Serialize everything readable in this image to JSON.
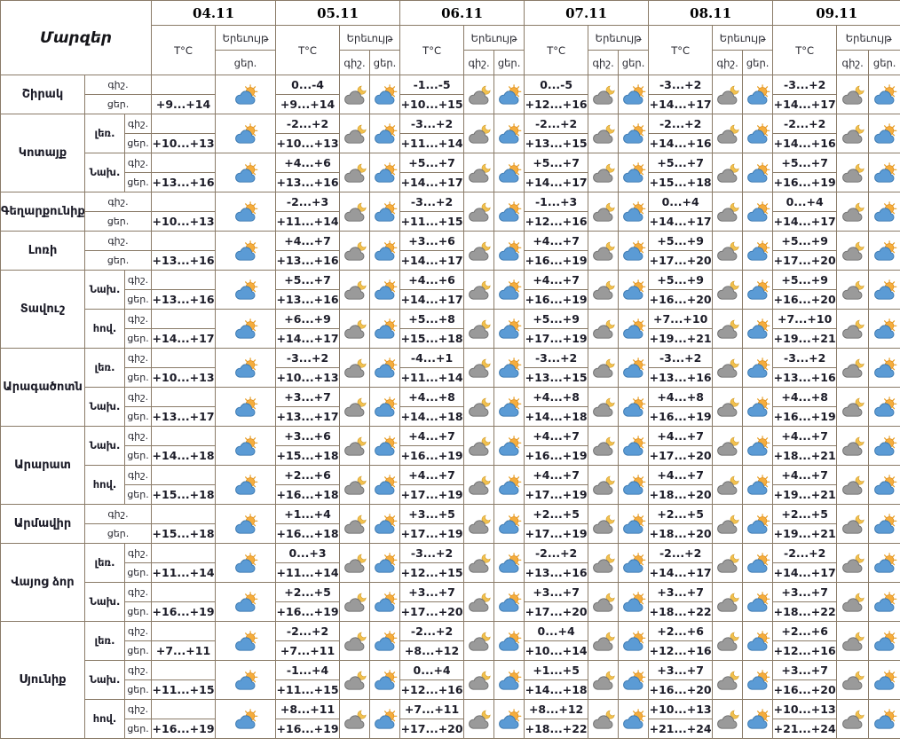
{
  "table": {
    "corner_label": "Մարզեր",
    "dates": [
      "04.11",
      "05.11",
      "06.11",
      "07.11",
      "08.11",
      "09.11"
    ],
    "temp_header": "T°C",
    "phenomenon_header": "Երեւույթ",
    "night_label": "գիշ.",
    "day_label": "ցեր.",
    "night_icon": "cloud-moon-icon",
    "day_icon": "cloud-sun-icon",
    "colors": {
      "border": "#8a7b68",
      "text": "#1c1c28",
      "day_cloud": "#5b9bd5",
      "night_cloud": "#9a9a9a",
      "sun": "#f5ad3d",
      "moon": "#f2c14e"
    },
    "regions": [
      {
        "name": "Շիրակ",
        "zones": [
          {
            "label": null,
            "cells": [
              {
                "night": "",
                "day": "+9...+14"
              },
              {
                "night": "0...-4",
                "day": "+9...+14"
              },
              {
                "night": "-1...-5",
                "day": "+10...+15"
              },
              {
                "night": "0...-5",
                "day": "+12...+16"
              },
              {
                "night": "-3...+2",
                "day": "+14...+17"
              },
              {
                "night": "-3...+2",
                "day": "+14...+17"
              }
            ]
          }
        ]
      },
      {
        "name": "Կոտայք",
        "zones": [
          {
            "label": "լեռ.",
            "cells": [
              {
                "night": "",
                "day": "+10...+13"
              },
              {
                "night": "-2...+2",
                "day": "+10...+13"
              },
              {
                "night": "-3...+2",
                "day": "+11...+14"
              },
              {
                "night": "-2...+2",
                "day": "+13...+15"
              },
              {
                "night": "-2...+2",
                "day": "+14...+16"
              },
              {
                "night": "-2...+2",
                "day": "+14...+16"
              }
            ]
          },
          {
            "label": "Նախ.",
            "cells": [
              {
                "night": "",
                "day": "+13...+16"
              },
              {
                "night": "+4...+6",
                "day": "+13...+16"
              },
              {
                "night": "+5...+7",
                "day": "+14...+17"
              },
              {
                "night": "+5...+7",
                "day": "+14...+17"
              },
              {
                "night": "+5...+7",
                "day": "+15...+18"
              },
              {
                "night": "+5...+7",
                "day": "+16...+19"
              }
            ]
          }
        ]
      },
      {
        "name": "Գեղարքունիք",
        "zones": [
          {
            "label": null,
            "cells": [
              {
                "night": "",
                "day": "+10...+13"
              },
              {
                "night": "-2...+3",
                "day": "+11...+14"
              },
              {
                "night": "-3...+2",
                "day": "+11...+15"
              },
              {
                "night": "-1...+3",
                "day": "+12...+16"
              },
              {
                "night": "0...+4",
                "day": "+14...+17"
              },
              {
                "night": "0...+4",
                "day": "+14...+17"
              }
            ]
          }
        ]
      },
      {
        "name": "Լոռի",
        "zones": [
          {
            "label": null,
            "cells": [
              {
                "night": "",
                "day": "+13...+16"
              },
              {
                "night": "+4...+7",
                "day": "+13...+16"
              },
              {
                "night": "+3...+6",
                "day": "+14...+17"
              },
              {
                "night": "+4...+7",
                "day": "+16...+19"
              },
              {
                "night": "+5...+9",
                "day": "+17...+20"
              },
              {
                "night": "+5...+9",
                "day": "+17...+20"
              }
            ]
          }
        ]
      },
      {
        "name": "Տավուշ",
        "zones": [
          {
            "label": "Նախ.",
            "cells": [
              {
                "night": "",
                "day": "+13...+16"
              },
              {
                "night": "+5...+7",
                "day": "+13...+16"
              },
              {
                "night": "+4...+6",
                "day": "+14...+17"
              },
              {
                "night": "+4...+7",
                "day": "+16...+19"
              },
              {
                "night": "+5...+9",
                "day": "+16...+20"
              },
              {
                "night": "+5...+9",
                "day": "+16...+20"
              }
            ]
          },
          {
            "label": "հով.",
            "cells": [
              {
                "night": "",
                "day": "+14...+17"
              },
              {
                "night": "+6...+9",
                "day": "+14...+17"
              },
              {
                "night": "+5...+8",
                "day": "+15...+18"
              },
              {
                "night": "+5...+9",
                "day": "+17...+19"
              },
              {
                "night": "+7...+10",
                "day": "+19...+21"
              },
              {
                "night": "+7...+10",
                "day": "+19...+21"
              }
            ]
          }
        ]
      },
      {
        "name": "Արագածոտն",
        "zones": [
          {
            "label": "լեռ.",
            "cells": [
              {
                "night": "",
                "day": "+10...+13"
              },
              {
                "night": "-3...+2",
                "day": "+10...+13"
              },
              {
                "night": "-4...+1",
                "day": "+11...+14"
              },
              {
                "night": "-3...+2",
                "day": "+13...+15"
              },
              {
                "night": "-3...+2",
                "day": "+13...+16"
              },
              {
                "night": "-3...+2",
                "day": "+13...+16"
              }
            ]
          },
          {
            "label": "Նախ.",
            "cells": [
              {
                "night": "",
                "day": "+13...+17"
              },
              {
                "night": "+3...+7",
                "day": "+13...+17"
              },
              {
                "night": "+4...+8",
                "day": "+14...+18"
              },
              {
                "night": "+4...+8",
                "day": "+14...+18"
              },
              {
                "night": "+4...+8",
                "day": "+16...+19"
              },
              {
                "night": "+4...+8",
                "day": "+16...+19"
              }
            ]
          }
        ]
      },
      {
        "name": "Արարատ",
        "zones": [
          {
            "label": "Նախ.",
            "cells": [
              {
                "night": "",
                "day": "+14...+18"
              },
              {
                "night": "+3...+6",
                "day": "+15...+18"
              },
              {
                "night": "+4...+7",
                "day": "+16...+19"
              },
              {
                "night": "+4...+7",
                "day": "+16...+19"
              },
              {
                "night": "+4...+7",
                "day": "+17...+20"
              },
              {
                "night": "+4...+7",
                "day": "+18...+21"
              }
            ]
          },
          {
            "label": "հով.",
            "cells": [
              {
                "night": "",
                "day": "+15...+18"
              },
              {
                "night": "+2...+6",
                "day": "+16...+18"
              },
              {
                "night": "+4...+7",
                "day": "+17...+19"
              },
              {
                "night": "+4...+7",
                "day": "+17...+19"
              },
              {
                "night": "+4...+7",
                "day": "+18...+20"
              },
              {
                "night": "+4...+7",
                "day": "+19...+21"
              }
            ]
          }
        ]
      },
      {
        "name": "Արմավիր",
        "zones": [
          {
            "label": null,
            "cells": [
              {
                "night": "",
                "day": "+15...+18"
              },
              {
                "night": "+1...+4",
                "day": "+16...+18"
              },
              {
                "night": "+3...+5",
                "day": "+17...+19"
              },
              {
                "night": "+2...+5",
                "day": "+17...+19"
              },
              {
                "night": "+2...+5",
                "day": "+18...+20"
              },
              {
                "night": "+2...+5",
                "day": "+19...+21"
              }
            ]
          }
        ]
      },
      {
        "name": "Վայոց ձոր",
        "zones": [
          {
            "label": "լեռ.",
            "cells": [
              {
                "night": "",
                "day": "+11...+14"
              },
              {
                "night": "0...+3",
                "day": "+11...+14"
              },
              {
                "night": "-3...+2",
                "day": "+12...+15"
              },
              {
                "night": "-2...+2",
                "day": "+13...+16"
              },
              {
                "night": "-2...+2",
                "day": "+14...+17"
              },
              {
                "night": "-2...+2",
                "day": "+14...+17"
              }
            ]
          },
          {
            "label": "Նախ.",
            "cells": [
              {
                "night": "",
                "day": "+16...+19"
              },
              {
                "night": "+2...+5",
                "day": "+16...+19"
              },
              {
                "night": "+3...+7",
                "day": "+17...+20"
              },
              {
                "night": "+3...+7",
                "day": "+17...+20"
              },
              {
                "night": "+3...+7",
                "day": "+18...+22"
              },
              {
                "night": "+3...+7",
                "day": "+18...+22"
              }
            ]
          }
        ]
      },
      {
        "name": "Սյունիք",
        "zones": [
          {
            "label": "լեռ.",
            "cells": [
              {
                "night": "",
                "day": "+7...+11"
              },
              {
                "night": "-2...+2",
                "day": "+7...+11"
              },
              {
                "night": "-2...+2",
                "day": "+8...+12"
              },
              {
                "night": "0...+4",
                "day": "+10...+14"
              },
              {
                "night": "+2...+6",
                "day": "+12...+16"
              },
              {
                "night": "+2...+6",
                "day": "+12...+16"
              }
            ]
          },
          {
            "label": "Նախ.",
            "cells": [
              {
                "night": "",
                "day": "+11...+15"
              },
              {
                "night": "-1...+4",
                "day": "+11...+15"
              },
              {
                "night": "0...+4",
                "day": "+12...+16"
              },
              {
                "night": "+1...+5",
                "day": "+14...+18"
              },
              {
                "night": "+3...+7",
                "day": "+16...+20"
              },
              {
                "night": "+3...+7",
                "day": "+16...+20"
              }
            ]
          },
          {
            "label": "հով.",
            "cells": [
              {
                "night": "",
                "day": "+16...+19"
              },
              {
                "night": "+8...+11",
                "day": "+16...+19"
              },
              {
                "night": "+7...+11",
                "day": "+17...+20"
              },
              {
                "night": "+8...+12",
                "day": "+18...+22"
              },
              {
                "night": "+10...+13",
                "day": "+21...+24"
              },
              {
                "night": "+10...+13",
                "day": "+21...+24"
              }
            ]
          }
        ]
      }
    ]
  }
}
